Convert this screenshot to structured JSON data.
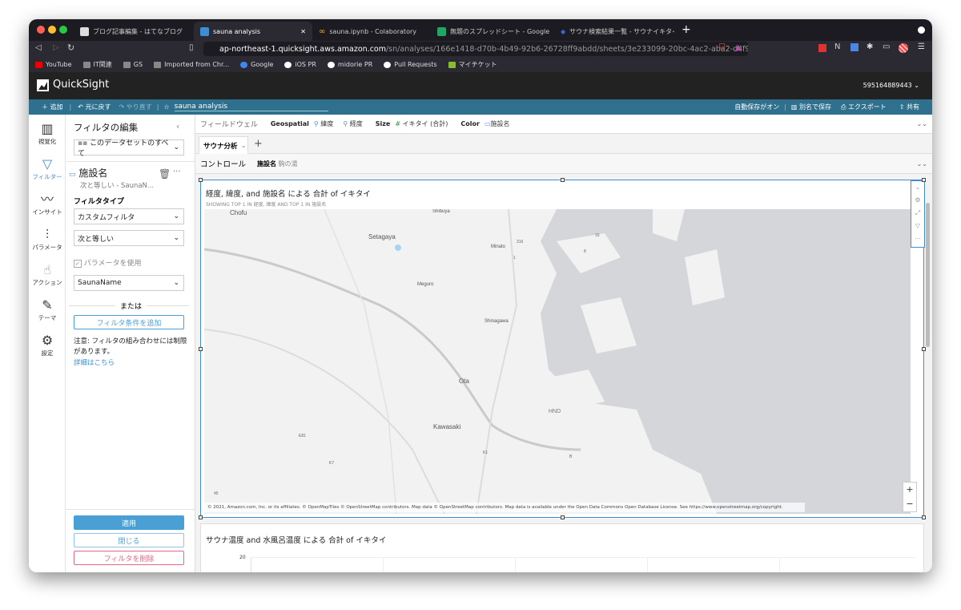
{
  "browser": {
    "tabs": [
      {
        "title": "ブログ記事編集 - はてなブログ",
        "active": false
      },
      {
        "title": "sauna analysis",
        "active": true
      },
      {
        "title": "sauna.ipynb - Colaboratory",
        "active": false
      },
      {
        "title": "無題のスプレッドシート - Google スプ",
        "active": false
      },
      {
        "title": "サウナ検索結果一覧 - サウナイキタイ",
        "active": false
      }
    ],
    "new_tab": "+",
    "url_host": "ap-northeast-1.quicksight.aws.amazon.com",
    "url_path": "/sn/analyses/166e1418-d70b-4b49-92b6-26728ff9abdd/sheets/3e233099-20bc-4ac2-aba2-d4f96...",
    "brave_badge": "1",
    "ext_badge": "6",
    "bookmarks": [
      "YouTube",
      "IT関連",
      "GS",
      "Imported from Chr...",
      "Google",
      "iOS PR",
      "midorie PR",
      "Pull Requests",
      "マイチケット"
    ]
  },
  "app": {
    "name": "QuickSight",
    "account": "595164889443"
  },
  "toolbar": {
    "add": "追加",
    "undo": "元に戻す",
    "redo": "やり直す",
    "analysis_name": "sauna analysis",
    "autosave": "自動保存がオン",
    "save_as": "別名で保存",
    "export": "エクスポート",
    "share": "共有"
  },
  "rail": [
    {
      "label": "視覚化",
      "icon": "bar-chart-icon"
    },
    {
      "label": "フィルター",
      "icon": "filter-icon",
      "active": true
    },
    {
      "label": "インサイト",
      "icon": "insight-icon"
    },
    {
      "label": "パラメータ",
      "icon": "sliders-icon"
    },
    {
      "label": "アクション",
      "icon": "pointer-gear-icon"
    },
    {
      "label": "テーマ",
      "icon": "brush-icon"
    },
    {
      "label": "設定",
      "icon": "gear-icon"
    }
  ],
  "filter_panel": {
    "title": "フィルタの編集",
    "scope": "このデータセットのすべて",
    "filter_name": "施設名",
    "filter_summary": "次と等しい - SaunaN...",
    "filter_type_label": "フィルタタイプ",
    "filter_type": "カスタムフィルタ",
    "condition": "次と等しい",
    "use_parameter": "パラメータを使用",
    "use_parameter_checked": true,
    "parameter": "SaunaName",
    "or": "または",
    "add_condition": "フィルタ条件を追加",
    "note": "注意: フィルタの組み合わせには制限があります。",
    "details_link": "詳細はこちら",
    "apply": "適用",
    "close": "閉じる",
    "delete": "フィルタを削除"
  },
  "field_well": {
    "label": "フィールドウェル",
    "geospatial": "Geospatial",
    "lat": "緯度",
    "lon": "経度",
    "size": "Size",
    "size_field": "イキタイ (合計)",
    "color": "Color",
    "color_field": "施設名"
  },
  "sheet_tab": "サウナ分析",
  "controls": {
    "label": "コントロール",
    "name": "施設名",
    "value": "駒の湯"
  },
  "map_visual": {
    "title": "経度, 緯度, and 施設名 による 合計 of イキタイ",
    "subtitle": "SHOWING TOP 1 IN 経度, 緯度 AND TOP 1 IN 施設名",
    "places": [
      "Chofu",
      "Setagaya",
      "Shibuya",
      "Minato",
      "Meguro",
      "Shinagawa",
      "Ota",
      "HND",
      "Kawasaki"
    ],
    "road_shields": [
      "316",
      "1",
      "8",
      "15",
      "E81",
      "K7",
      "K1",
      "45",
      "B"
    ],
    "attribution": "© 2021, Amazon.com, Inc. or its affiliates. © OpenMapTiles © OpenStreetMap contributors. Map data © OpenStreetMap contributors. Map data is available under the Open Data Commons Open Database License. See https://www.openstreetmap.org/copyright.",
    "zoom_in": "+",
    "zoom_out": "−",
    "point_color": "#a8d4ef",
    "water_color": "#d4d6d9",
    "land_color": "#f2f2f2"
  },
  "second_visual": {
    "title": "サウナ温度 and 水風呂温度 による 合計 of イキタイ",
    "y_tick": "20"
  },
  "colors": {
    "accent": "#30708f",
    "primary_button": "#4a9fd5",
    "delete": "#e06a85",
    "active_rail": "#3f8ed1"
  }
}
